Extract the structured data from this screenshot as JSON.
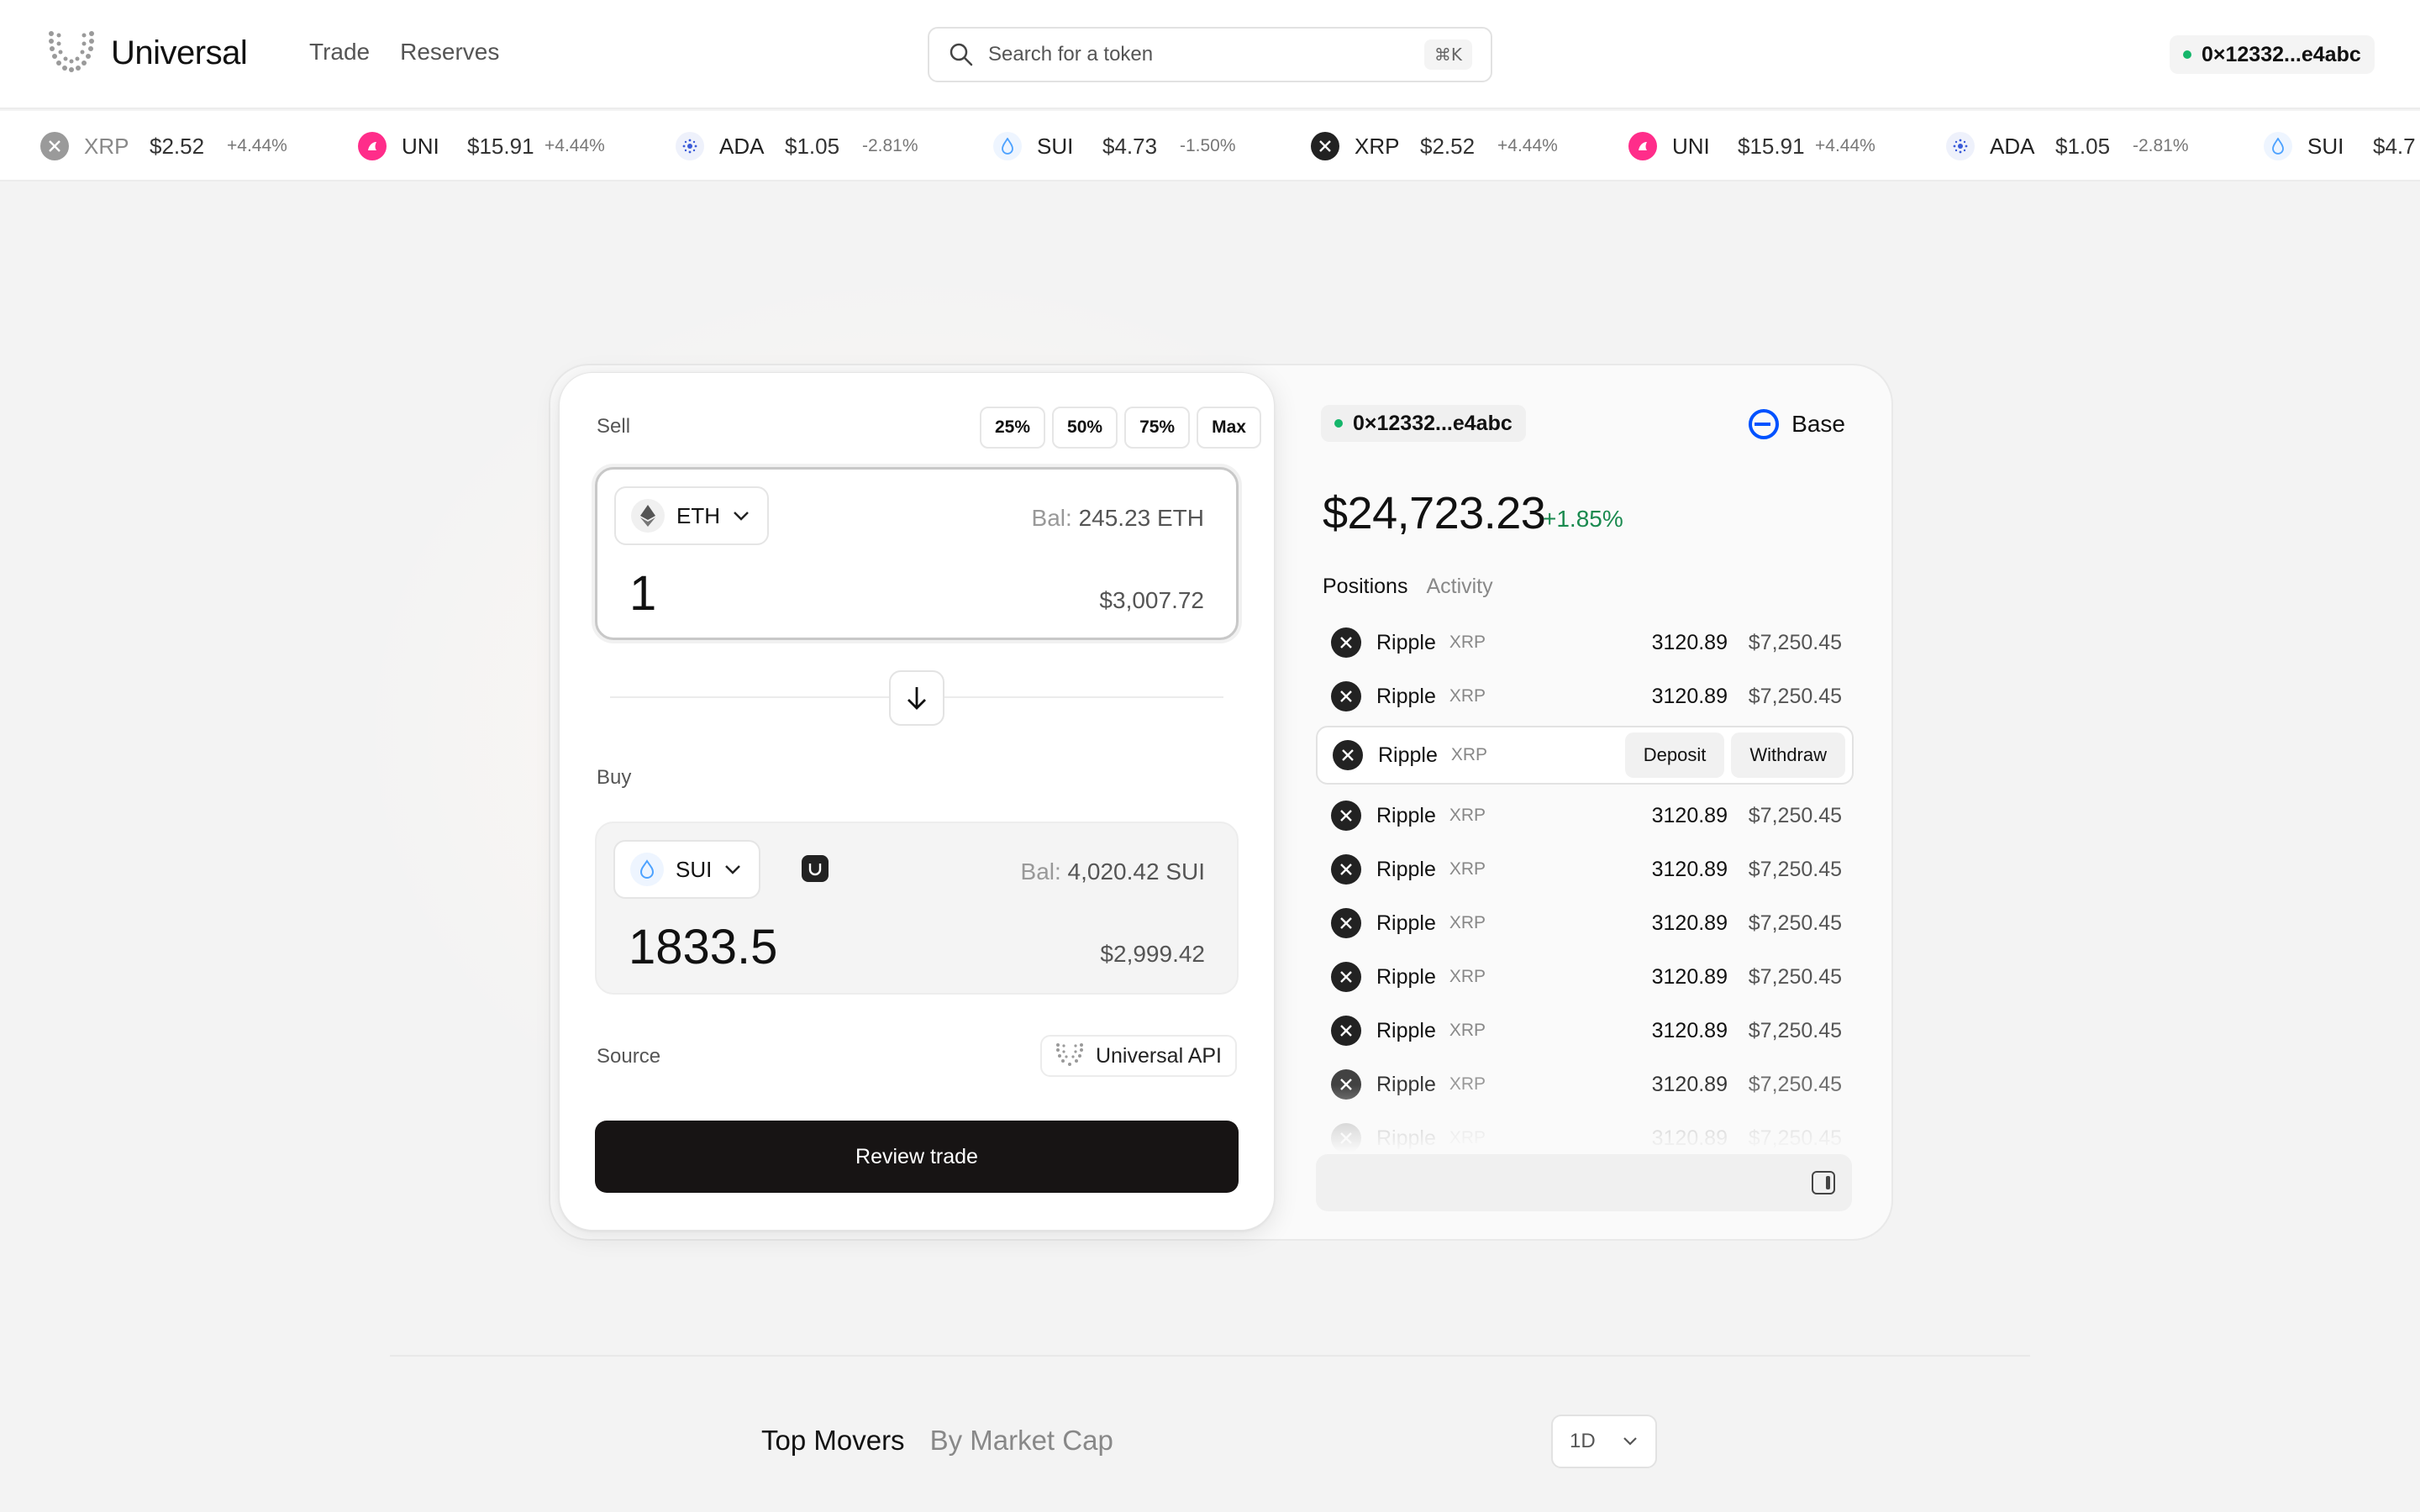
{
  "app": {
    "name": "Universal"
  },
  "nav": {
    "items": [
      "Trade",
      "Reserves"
    ]
  },
  "search": {
    "placeholder": "Search for a token",
    "shortcut": "⌘K"
  },
  "wallet": {
    "address": "0×12332...e4abc"
  },
  "ticker": [
    {
      "symbol": "XRP",
      "price": "$2.52",
      "change": "+4.44%",
      "icon": "xrp-icon",
      "color": "#9a9a9a"
    },
    {
      "symbol": "UNI",
      "price": "$15.91",
      "change": "+4.44%",
      "icon": "uni-icon",
      "color": "#ff2d8a"
    },
    {
      "symbol": "ADA",
      "price": "$1.05",
      "change": "-2.81%",
      "icon": "ada-icon",
      "color": "#3a5bd9"
    },
    {
      "symbol": "SUI",
      "price": "$4.73",
      "change": "-1.50%",
      "icon": "sui-icon",
      "color": "#4da2ff"
    },
    {
      "symbol": "XRP",
      "price": "$2.52",
      "change": "+4.44%",
      "icon": "xrp-icon",
      "color": "#222222"
    },
    {
      "symbol": "UNI",
      "price": "$15.91",
      "change": "+4.44%",
      "icon": "uni-icon",
      "color": "#ff2d8a"
    },
    {
      "symbol": "ADA",
      "price": "$1.05",
      "change": "-2.81%",
      "icon": "ada-icon",
      "color": "#3a5bd9"
    },
    {
      "symbol": "SUI",
      "price": "$4.7",
      "change": "",
      "icon": "sui-icon",
      "color": "#4da2ff"
    }
  ],
  "trade": {
    "sell_label": "Sell",
    "percent_buttons": [
      "25%",
      "50%",
      "75%",
      "Max"
    ],
    "sell": {
      "token": "ETH",
      "balance_label": "Bal:",
      "balance": "245.23 ETH",
      "amount": "1",
      "usd": "$3,007.72"
    },
    "buy_label": "Buy",
    "buy": {
      "token": "SUI",
      "balance_label": "Bal:",
      "balance": "4,020.42 SUI",
      "amount": "1833.5",
      "usd": "$2,999.42"
    },
    "source_label": "Source",
    "source_value": "Universal API",
    "review_label": "Review trade"
  },
  "portfolio": {
    "wallet": "0×12332...e4abc",
    "chain": "Base",
    "total": "$24,723.23",
    "change": "+1.85%",
    "tabs": [
      "Positions",
      "Activity"
    ],
    "deposit_label": "Deposit",
    "withdraw_label": "Withdraw",
    "positions": [
      {
        "name": "Ripple",
        "symbol": "XRP",
        "qty": "3120.89",
        "value": "$7,250.45"
      },
      {
        "name": "Ripple",
        "symbol": "XRP",
        "qty": "3120.89",
        "value": "$7,250.45"
      },
      {
        "name": "Ripple",
        "symbol": "XRP",
        "qty": "3120.89",
        "value": "$7,250.45",
        "highlighted": true
      },
      {
        "name": "Ripple",
        "symbol": "XRP",
        "qty": "3120.89",
        "value": "$7,250.45"
      },
      {
        "name": "Ripple",
        "symbol": "XRP",
        "qty": "3120.89",
        "value": "$7,250.45"
      },
      {
        "name": "Ripple",
        "symbol": "XRP",
        "qty": "3120.89",
        "value": "$7,250.45"
      },
      {
        "name": "Ripple",
        "symbol": "XRP",
        "qty": "3120.89",
        "value": "$7,250.45"
      },
      {
        "name": "Ripple",
        "symbol": "XRP",
        "qty": "3120.89",
        "value": "$7,250.45"
      },
      {
        "name": "Ripple",
        "symbol": "XRP",
        "qty": "3120.89",
        "value": "$7,250.45"
      },
      {
        "name": "Ripple",
        "symbol": "XRP",
        "qty": "3120.89",
        "value": "$7,250.45"
      }
    ]
  },
  "movers": {
    "tabs": [
      "Top Movers",
      "By Market Cap"
    ],
    "period": "1D"
  },
  "colors": {
    "accent_green": "#15b66b",
    "positive": "#1a8a4f",
    "button_dark": "#171414",
    "base_blue": "#0052ff"
  }
}
